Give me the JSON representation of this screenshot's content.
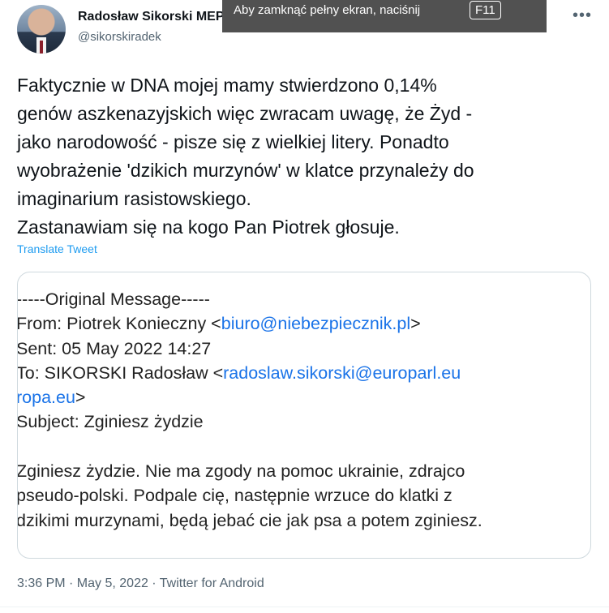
{
  "author": {
    "name": "Radosław Sikorski MEP",
    "handle": "@sikorskiradek"
  },
  "fullscreen_banner": {
    "text": "Aby zamknąć pełny ekran, naciśnij",
    "key": "F11"
  },
  "tweet": {
    "lines": [
      "Faktycznie w DNA mojej mamy stwierdzono 0,14%",
      "genów aszkenazyjskich więc zwracam uwagę, że Żyd -",
      "jako narodowość - pisze się z wielkiej litery. Ponadto",
      "wyobrażenie 'dzikich murzynów' w klatce przynależy do",
      "imaginarium rasistowskiego.",
      "Zastanawiam się na kogo Pan Piotrek głosuje."
    ],
    "translate_label": "Translate Tweet",
    "timestamp": "3:36 PM · May 5, 2022 · Twitter for Android"
  },
  "email": {
    "header": "-----Original Message-----",
    "from_prefix": "From: Piotrek Konieczny <",
    "from_email": "biuro@niebezpiecznik.pl",
    "from_suffix": ">",
    "sent": "Sent: 05 May 2022 14:27",
    "to_prefix": "To: SIKORSKI Radosław <",
    "to_email_part1": "radoslaw.sikorski@europarl.eu",
    "to_email_part2": "ropa.eu",
    "to_suffix": ">",
    "subject": "Subject: Zginiesz żydzie",
    "body_lines": [
      "Zginiesz żydzie. Nie ma zgody na pomoc ukrainie, zdrajco",
      "pseudo-polski. Podpale cię, następnie wrzuce do klatki z",
      "dzikimi murzynami, będą jebać cie jak psa a potem zginiesz."
    ]
  },
  "icons": {
    "more": "more-options-icon",
    "verified": "verified-badge-icon"
  },
  "colors": {
    "link": "#1d9bf0",
    "email_link": "#1a73e8",
    "secondary_text": "#536471",
    "banner_bg": "#515151"
  }
}
